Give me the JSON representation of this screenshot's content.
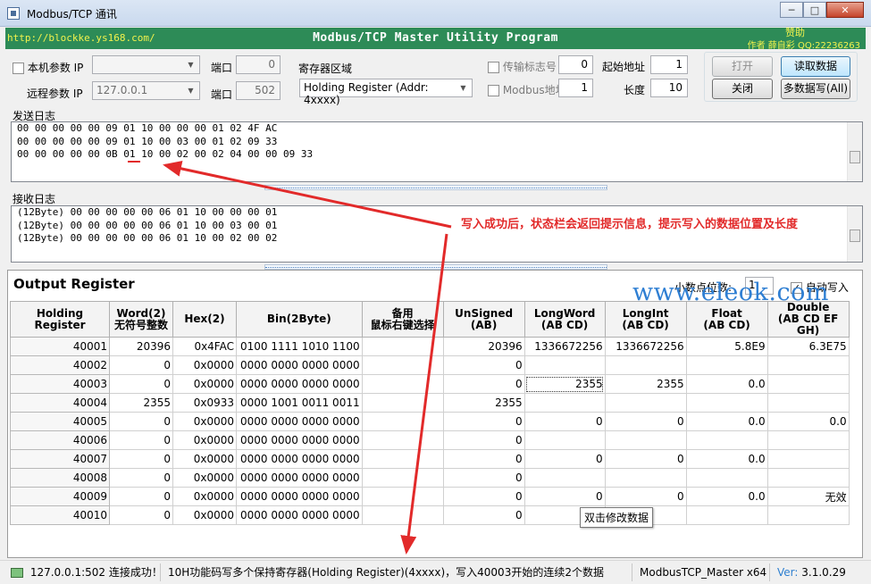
{
  "window": {
    "title": "Modbus/TCP 通讯",
    "controls": [
      "─",
      "□",
      "✕"
    ]
  },
  "banner": {
    "url": "http://blockke.ys168.com/",
    "program": "Modbus/TCP Master Utility Program",
    "sponsor": "赞助",
    "author": "作者  薛自彩  QQ:22236263"
  },
  "settings": {
    "local_param_label": "本机参数 IP",
    "local_port_label": "端口",
    "local_port_value": "0",
    "remote_param_label": "远程参数 IP",
    "remote_ip_value": "127.0.0.1",
    "remote_port_label": "端口",
    "remote_port_value": "502",
    "register_area_label": "寄存器区域",
    "register_area_value": "Holding Register (Addr: 4xxxx)",
    "transfer_flag_label": "传输标志号",
    "transfer_flag_value": "0",
    "modbus_addr_label": "Modbus地址",
    "modbus_addr_value": "1",
    "start_addr_label": "起始地址",
    "start_addr_value": "1",
    "length_label": "长度",
    "length_value": "10"
  },
  "buttons": {
    "open": "打开",
    "read": "读取数据",
    "close": "关闭",
    "multi_write": "多数据写(All)"
  },
  "send_log": {
    "label": "发送日志",
    "lines": [
      "00 00 00 00 00 09 01 10 00 00 00 01 02 4F AC",
      "00 00 00 00 00 09 01 10 00 03 00 01 02 09 33",
      "00 00 00 00 00 0B 01 10 00 02 00 02 04 00 00 09 33"
    ]
  },
  "recv_log": {
    "label": "接收日志",
    "lines": [
      "(12Byte) 00 00 00 00 00 06 01 10 00 00 00 01",
      "(12Byte) 00 00 00 00 00 06 01 10 00 03 00 01",
      "(12Byte) 00 00 00 00 00 06 01 10 00 02 00 02"
    ]
  },
  "annotation": "写入成功后，状态栏会返回提示信息，提示写入的数据位置及长度",
  "watermark": "www.eleok.com",
  "register_panel": {
    "title": "Output Register",
    "decimal_label": "小数点位数:",
    "decimal_value": "1",
    "auto_write_label": "自动写入",
    "headers": [
      [
        "Holding Register"
      ],
      [
        "Word(2)",
        "无符号整数"
      ],
      [
        "Hex(2)"
      ],
      [
        "Bin(2Byte)"
      ],
      [
        "备用",
        "鼠标右键选择"
      ],
      [
        "UnSigned",
        "(AB)"
      ],
      [
        "LongWord",
        "(AB CD)"
      ],
      [
        "LongInt",
        "(AB CD)"
      ],
      [
        "Float",
        "(AB CD)"
      ],
      [
        "Double",
        "(AB CD EF GH)"
      ]
    ],
    "rows": [
      [
        "40001",
        "20396",
        "0x4FAC",
        "0100 1111 1010 1100",
        "",
        "20396",
        "1336672256",
        "1336672256",
        "5.8E9",
        "6.3E75"
      ],
      [
        "40002",
        "0",
        "0x0000",
        "0000 0000 0000 0000",
        "",
        "0",
        "",
        "",
        "",
        ""
      ],
      [
        "40003",
        "0",
        "0x0000",
        "0000 0000 0000 0000",
        "",
        "0",
        "2355",
        "2355",
        "0.0",
        ""
      ],
      [
        "40004",
        "2355",
        "0x0933",
        "0000 1001 0011 0011",
        "",
        "2355",
        "",
        "",
        "",
        ""
      ],
      [
        "40005",
        "0",
        "0x0000",
        "0000 0000 0000 0000",
        "",
        "0",
        "0",
        "0",
        "0.0",
        "0.0"
      ],
      [
        "40006",
        "0",
        "0x0000",
        "0000 0000 0000 0000",
        "",
        "0",
        "",
        "",
        "",
        ""
      ],
      [
        "40007",
        "0",
        "0x0000",
        "0000 0000 0000 0000",
        "",
        "0",
        "0",
        "0",
        "0.0",
        ""
      ],
      [
        "40008",
        "0",
        "0x0000",
        "0000 0000 0000 0000",
        "",
        "0",
        "",
        "",
        "",
        ""
      ],
      [
        "40009",
        "0",
        "0x0000",
        "0000 0000 0000 0000",
        "",
        "0",
        "0",
        "0",
        "0.0",
        "无效"
      ],
      [
        "40010",
        "0",
        "0x0000",
        "0000 0000 0000 0000",
        "",
        "0",
        "",
        "",
        "",
        ""
      ]
    ],
    "tooltip": "双击修改数据"
  },
  "statusbar": {
    "connection": "127.0.0.1:502 连接成功！",
    "message": "10H功能码写多个保持寄存器(Holding Register)(4xxxx)，写入40003开始的连续2个数据",
    "app": "ModbusTCP_Master x64",
    "version_label": "Ver:",
    "version": "3.1.0.29"
  }
}
